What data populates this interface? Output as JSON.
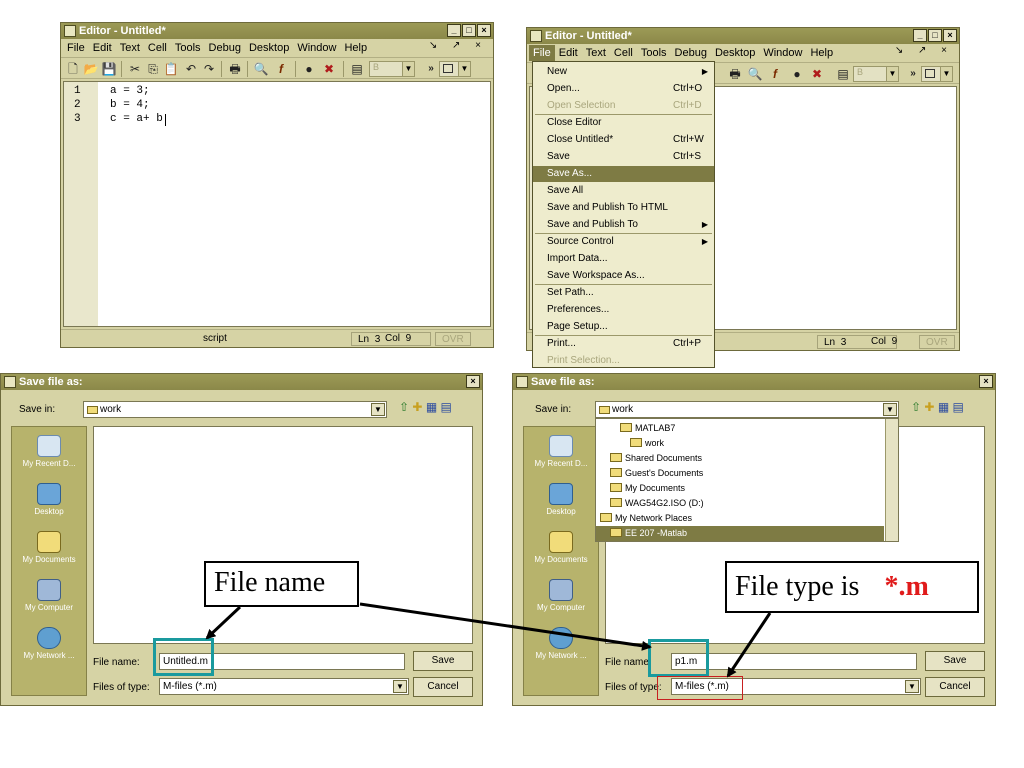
{
  "editor1": {
    "title": "Editor - Untitled*",
    "menus": [
      "File",
      "Edit",
      "Text",
      "Cell",
      "Tools",
      "Debug",
      "Desktop",
      "Window",
      "Help"
    ],
    "menu_right": "↘ ↗ ×",
    "line_numbers": [
      "1",
      "2",
      "3"
    ],
    "code_lines": [
      "a = 3;",
      "b = 4;",
      "c = a+ b"
    ],
    "status": {
      "mode": "script",
      "ln_label": "Ln",
      "ln": "3",
      "col_label": "Col",
      "col": "9",
      "ovr": "OVR"
    },
    "combo_value": "B"
  },
  "editor2": {
    "title": "Editor - Untitled*",
    "menus": [
      "File",
      "Edit",
      "Text",
      "Cell",
      "Tools",
      "Debug",
      "Desktop",
      "Window",
      "Help"
    ],
    "menu_right": "↘ ↗ ×",
    "status": {
      "ln_label": "Ln",
      "ln": "3",
      "col_label": "Col",
      "col": "9",
      "ovr": "OVR"
    },
    "combo_value": "B",
    "file_menu": [
      {
        "label": "New",
        "shortcut": "",
        "submenu": true,
        "disabled": false,
        "highlight": false
      },
      {
        "label": "Open...",
        "shortcut": "Ctrl+O",
        "submenu": false,
        "disabled": false,
        "highlight": false
      },
      {
        "label": "Open Selection",
        "shortcut": "Ctrl+D",
        "submenu": false,
        "disabled": true,
        "highlight": false
      },
      {
        "label": "Close Editor",
        "shortcut": "",
        "submenu": false,
        "disabled": false,
        "highlight": false
      },
      {
        "label": "Close Untitled*",
        "shortcut": "Ctrl+W",
        "submenu": false,
        "disabled": false,
        "highlight": false
      },
      {
        "label": "Save",
        "shortcut": "Ctrl+S",
        "submenu": false,
        "disabled": false,
        "highlight": false
      },
      {
        "label": "Save As...",
        "shortcut": "",
        "submenu": false,
        "disabled": false,
        "highlight": true
      },
      {
        "label": "Save All",
        "shortcut": "",
        "submenu": false,
        "disabled": false,
        "highlight": false
      },
      {
        "label": "Save and Publish To HTML",
        "shortcut": "",
        "submenu": false,
        "disabled": false,
        "highlight": false
      },
      {
        "label": "Save and Publish To",
        "shortcut": "",
        "submenu": true,
        "disabled": false,
        "highlight": false
      },
      {
        "label": "Source Control",
        "shortcut": "",
        "submenu": true,
        "disabled": false,
        "highlight": false
      },
      {
        "label": "Import Data...",
        "shortcut": "",
        "submenu": false,
        "disabled": false,
        "highlight": false
      },
      {
        "label": "Save Workspace As...",
        "shortcut": "",
        "submenu": false,
        "disabled": false,
        "highlight": false
      },
      {
        "label": "Set Path...",
        "shortcut": "",
        "submenu": false,
        "disabled": false,
        "highlight": false
      },
      {
        "label": "Preferences...",
        "shortcut": "",
        "submenu": false,
        "disabled": false,
        "highlight": false
      },
      {
        "label": "Page Setup...",
        "shortcut": "",
        "submenu": false,
        "disabled": false,
        "highlight": false
      },
      {
        "label": "Print...",
        "shortcut": "Ctrl+P",
        "submenu": false,
        "disabled": false,
        "highlight": false
      },
      {
        "label": "Print Selection...",
        "shortcut": "",
        "submenu": false,
        "disabled": true,
        "highlight": false
      }
    ]
  },
  "dialog1": {
    "title": "Save file as:",
    "save_in_label": "Save in:",
    "save_in_value": "work",
    "places": [
      "My Recent D...",
      "Desktop",
      "My Documents",
      "My Computer",
      "My Network ..."
    ],
    "file_name_label": "File name:",
    "file_name_value": "Untitled.m",
    "file_type_label": "Files of type:",
    "file_type_value": "M-files (*.m)",
    "save_button": "Save",
    "cancel_button": "Cancel"
  },
  "dialog2": {
    "title": "Save file as:",
    "save_in_label": "Save in:",
    "save_in_value": "work",
    "places": [
      "My Recent D...",
      "Desktop",
      "My Documents",
      "My Computer",
      "My Network ..."
    ],
    "dropdown_items": [
      {
        "label": "MATLAB7",
        "indent": 1,
        "highlight": false
      },
      {
        "label": "work",
        "indent": 2,
        "highlight": false
      },
      {
        "label": "Shared Documents",
        "indent": 0,
        "highlight": false
      },
      {
        "label": "Guest's Documents",
        "indent": 0,
        "highlight": false
      },
      {
        "label": "My Documents",
        "indent": 0,
        "highlight": false
      },
      {
        "label": "WAG54G2.ISO (D:)",
        "indent": 0,
        "highlight": false
      },
      {
        "label": "My Network Places",
        "indent": -1,
        "highlight": false
      },
      {
        "label": "EE 207 -Matlab",
        "indent": 0,
        "highlight": true
      }
    ],
    "file_name_label": "File name:",
    "file_name_value": "p1.m",
    "file_type_label": "Files of type:",
    "file_type_value": "M-files (*.m)",
    "save_button": "Save",
    "cancel_button": "Cancel"
  },
  "annotations": {
    "file_name_callout": "File name",
    "file_type_callout": "File type is",
    "file_type_ext": "*.m",
    "teal": "#1a9a9e",
    "red": "#e01b1b"
  }
}
